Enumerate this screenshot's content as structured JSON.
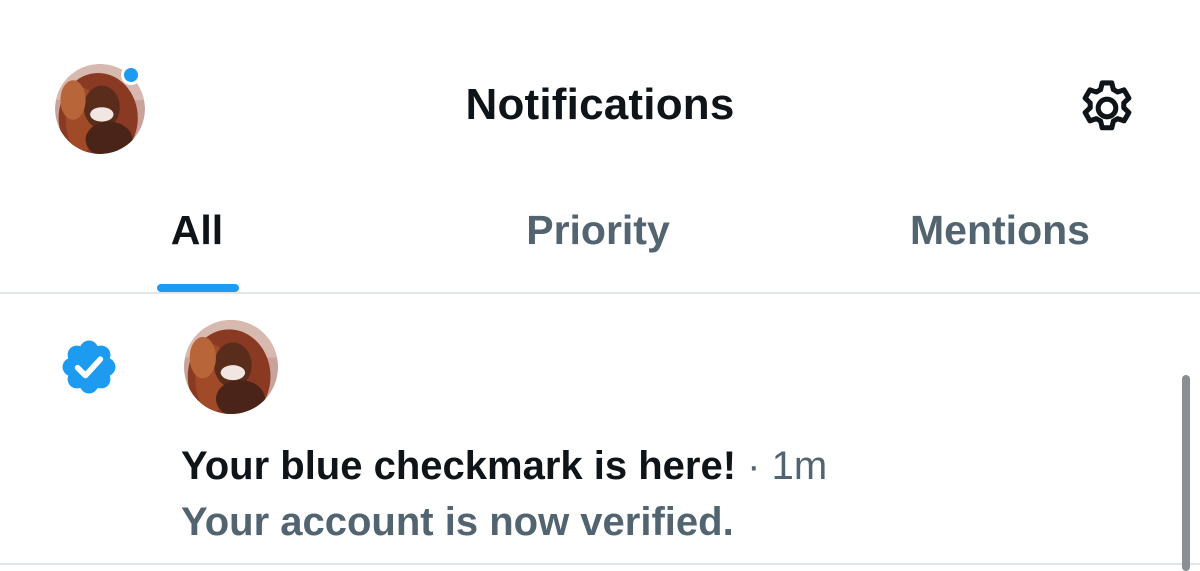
{
  "header": {
    "title": "Notifications",
    "avatar_icon": "profile-photo",
    "settings_icon": "gear-icon",
    "dot_color": "#1d9bf0"
  },
  "tabs": [
    {
      "label": "All",
      "active": true
    },
    {
      "label": "Priority",
      "active": false
    },
    {
      "label": "Mentions",
      "active": false
    }
  ],
  "colors": {
    "accent": "#1d9bf0",
    "text_primary": "#0f1419",
    "text_secondary": "#536471"
  },
  "notification": {
    "icon": "verified-badge-icon",
    "title": "Your blue checkmark is here!",
    "separator": " · ",
    "time": "1m",
    "body": "Your account is now verified."
  }
}
